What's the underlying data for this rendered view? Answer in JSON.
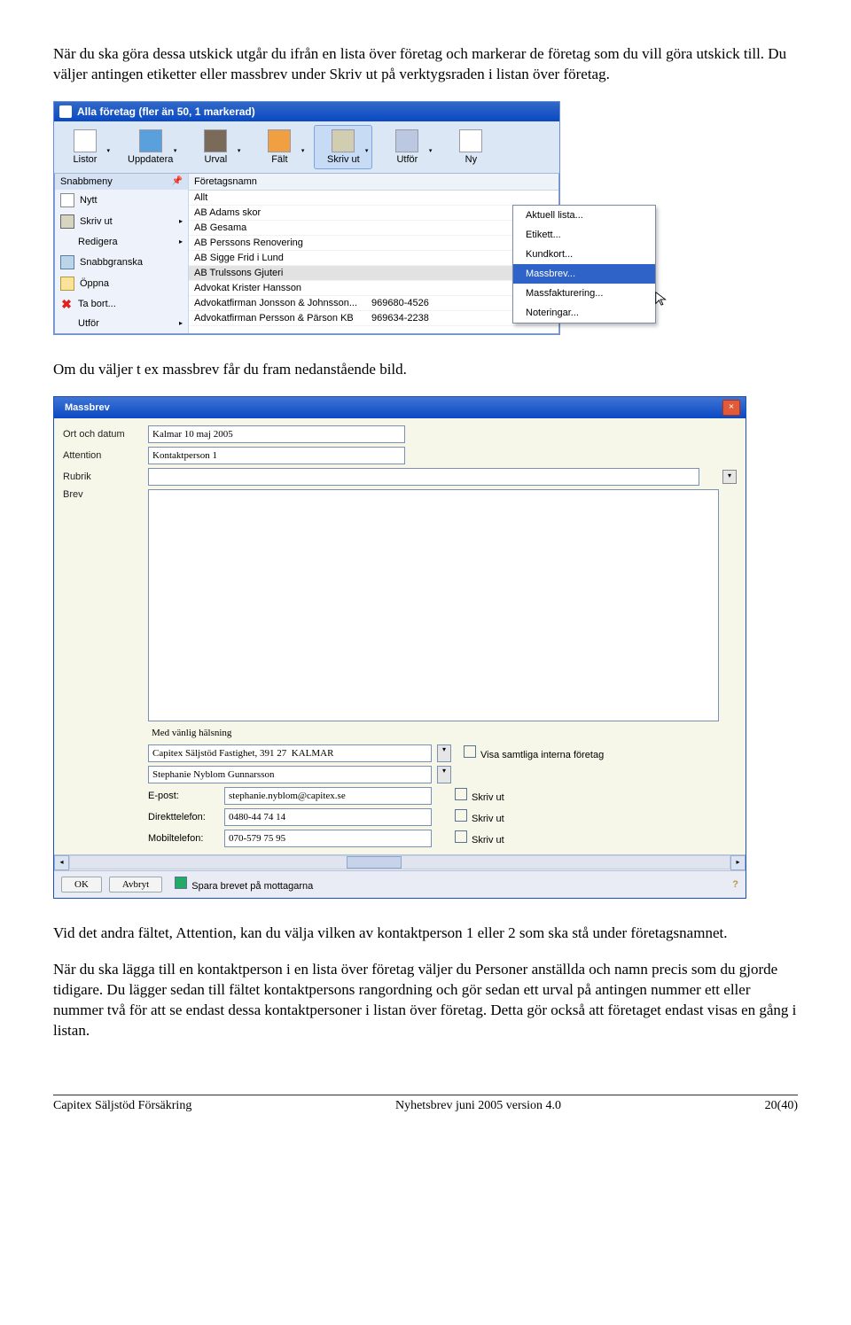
{
  "intro_p1": "När du ska göra dessa utskick utgår du ifrån en lista över företag och markerar de företag som du vill göra utskick till. Du väljer antingen etiketter eller massbrev under Skriv ut på verktygsraden i listan över företag.",
  "intro_p2": "Om du väljer t ex massbrev får du fram nedanstående bild.",
  "intro_p3": "Vid det andra fältet, Attention, kan du välja vilken av kontaktperson 1 eller 2 som ska stå under företagsnamnet.",
  "intro_p4": "När du ska lägga till en kontaktperson i en lista över företag väljer du Personer anställda och namn precis som du gjorde tidigare. Du lägger sedan till fältet kontaktpersons rangordning och gör sedan ett urval på antingen nummer ett eller nummer två för att se endast dessa kontaktpersoner i listan över företag. Detta gör också att företaget endast visas en gång i listan.",
  "s1": {
    "title": "Alla företag (fler än 50, 1 markerad)",
    "toolbar": [
      "Listor",
      "Uppdatera",
      "Urval",
      "Fält",
      "Skriv ut",
      "Utför",
      "Ny"
    ],
    "sidebar_hd": "Snabbmeny",
    "sidebar": [
      {
        "icon": "si-new",
        "label": "Nytt"
      },
      {
        "icon": "si-print",
        "label": "Skriv ut",
        "sub": true
      },
      {
        "icon": "",
        "label": "Redigera",
        "sub": true
      },
      {
        "icon": "si-view",
        "label": "Snabbgranska"
      },
      {
        "icon": "si-open",
        "label": "Öppna"
      },
      {
        "icon": "si-del",
        "label": "Ta bort..."
      },
      {
        "icon": "",
        "label": "Utför",
        "sub": true
      }
    ],
    "col_head": "Företagsnamn",
    "rows": [
      {
        "name": "Allt",
        "phone": ""
      },
      {
        "name": "AB Adams skor",
        "phone": ""
      },
      {
        "name": "AB Gesama",
        "phone": ""
      },
      {
        "name": "AB Perssons Renovering",
        "phone": ""
      },
      {
        "name": "AB Sigge Frid i Lund",
        "phone": ""
      },
      {
        "name": "AB Trulssons Gjuteri",
        "phone": "",
        "sel": true
      },
      {
        "name": "Advokat Krister Hansson",
        "phone": ""
      },
      {
        "name": "Advokatfirman Jonsson & Johnsson...",
        "phone": "969680-4526"
      },
      {
        "name": "Advokatfirman Persson & Pärson KB",
        "phone": "969634-2238"
      }
    ],
    "ctx": [
      "Aktuell lista...",
      "Etikett...",
      "Kundkort...",
      "Massbrev...",
      "Massfakturering...",
      "Noteringar..."
    ],
    "ctx_hl": 3
  },
  "s2": {
    "title": "Massbrev",
    "fields": {
      "ort_lbl": "Ort och datum",
      "ort_val": "Kalmar 10 maj 2005",
      "att_lbl": "Attention",
      "att_val": "Kontaktperson 1",
      "rub_lbl": "Rubrik",
      "rub_val": "",
      "brev_lbl": "Brev"
    },
    "closing_text": "Med vänlig hälsning",
    "company": "Capitex Säljstöd Fastighet, 391 27  KALMAR",
    "sender": "Stephanie Nyblom Gunnarsson",
    "show_all_lbl": "Visa samtliga interna företag",
    "epost_lbl": "E-post:",
    "epost_val": "stephanie.nyblom@capitex.se",
    "tel_lbl": "Direkttelefon:",
    "tel_val": "0480-44 74 14",
    "mob_lbl": "Mobiltelefon:",
    "mob_val": "070-579 75 95",
    "cb_lbl": "Skriv ut",
    "btn_ok": "OK",
    "btn_cancel": "Avbryt",
    "save_lbl": "Spara brevet på mottagarna"
  },
  "footer": {
    "left": "Capitex Säljstöd Försäkring",
    "mid": "Nyhetsbrev juni 2005 version 4.0",
    "right": "20(40)"
  }
}
